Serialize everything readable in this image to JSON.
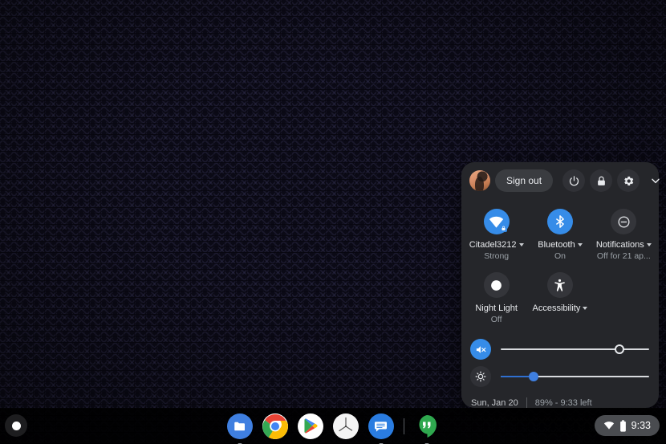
{
  "wallpaper": {
    "pattern": "herringbone",
    "base_color": "#0b0a16",
    "stripe_color": "#3c3a5f"
  },
  "system_tray": {
    "top_bar": {
      "avatar_name": "user-avatar",
      "sign_out_label": "Sign out",
      "power_icon": "power-icon",
      "lock_icon": "lock-icon",
      "settings_icon": "gear-icon",
      "collapse_icon": "chevron-down-icon"
    },
    "tiles": [
      {
        "id": "network",
        "icon": "wifi-locked-icon",
        "label": "Citadel3212",
        "sub": "Strong",
        "state": "active",
        "has_caret": true
      },
      {
        "id": "bluetooth",
        "icon": "bluetooth-icon",
        "label": "Bluetooth",
        "sub": "On",
        "state": "active",
        "has_caret": true
      },
      {
        "id": "notifications",
        "icon": "do-not-disturb-icon",
        "label": "Notifications",
        "sub": "Off for 21 ap...",
        "state": "inactive",
        "has_caret": true
      },
      {
        "id": "night-light",
        "icon": "moon-icon",
        "label": "Night Light",
        "sub": "Off",
        "state": "inactive",
        "has_caret": false
      },
      {
        "id": "accessibility",
        "icon": "accessibility-icon",
        "label": "Accessibility",
        "sub": "",
        "state": "inactive",
        "has_caret": true
      }
    ],
    "sliders": [
      {
        "id": "volume",
        "icon": "volume-muted-icon",
        "icon_style": "blue",
        "value": 80,
        "fill": 0,
        "thumb_style": "hollow"
      },
      {
        "id": "brightness",
        "icon": "brightness-icon",
        "icon_style": "grey",
        "value": 22,
        "fill": 22,
        "thumb_style": "solid"
      }
    ],
    "bottom": {
      "date": "Sun, Jan 20",
      "battery": "89% - 9:33 left"
    },
    "accent_color": "#368ce8",
    "background_color": "#25262a"
  },
  "shelf": {
    "launcher_name": "launcher-button",
    "apps": [
      {
        "id": "files",
        "name": "files-app-icon",
        "running": true
      },
      {
        "id": "chrome",
        "name": "chrome-app-icon",
        "running": true
      },
      {
        "id": "play-store",
        "name": "play-store-app-icon",
        "running": false
      },
      {
        "id": "clock",
        "name": "clock-app-icon",
        "running": false
      },
      {
        "id": "messages",
        "name": "messages-app-icon",
        "running": true
      },
      {
        "id": "separator",
        "name": "shelf-separator",
        "running": false
      },
      {
        "id": "hangouts",
        "name": "hangouts-app-icon",
        "running": true
      }
    ],
    "status_area": {
      "wifi_icon": "wifi-icon",
      "battery_icon": "battery-icon",
      "clock": "9:33"
    }
  }
}
